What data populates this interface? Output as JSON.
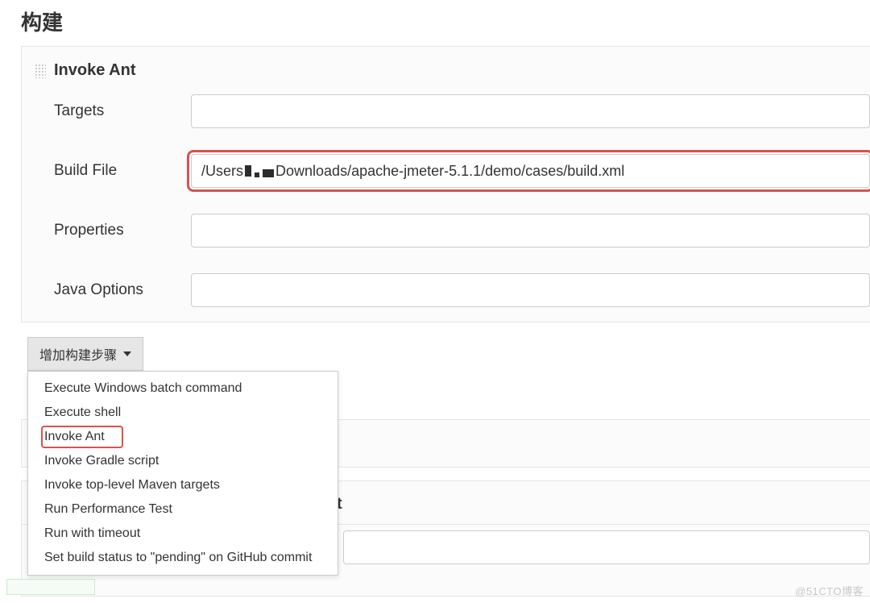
{
  "section": {
    "title": "构建"
  },
  "step": {
    "title": "Invoke Ant",
    "fields": {
      "targets": {
        "label": "Targets",
        "value": ""
      },
      "build_file": {
        "label": "Build File",
        "prefix": "/Users",
        "suffix": "Downloads/apache-jmeter-5.1.1/demo/cases/build.xml"
      },
      "properties": {
        "label": "Properties",
        "value": ""
      },
      "java_options": {
        "label": "Java Options",
        "value": ""
      }
    }
  },
  "add_button": {
    "label": "增加构建步骤"
  },
  "dropdown": {
    "items": [
      "Execute Windows batch command",
      "Execute shell",
      "Invoke Ant",
      "Invoke Gradle script",
      "Invoke top-level Maven targets",
      "Run Performance Test",
      "Run with timeout",
      "Set build status to \"pending\" on GitHub commit"
    ],
    "highlighted_index": 2
  },
  "background": {
    "partial_char": "⟳",
    "partial_label_suffix": "t"
  },
  "watermark": "@51CTO博客"
}
